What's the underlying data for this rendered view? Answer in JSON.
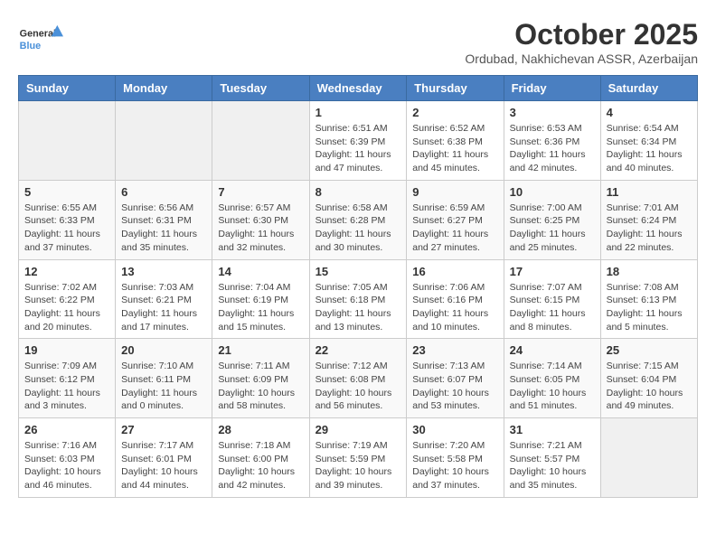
{
  "header": {
    "logo_line1": "General",
    "logo_line2": "Blue",
    "month": "October 2025",
    "location": "Ordubad, Nakhichevan ASSR, Azerbaijan"
  },
  "weekdays": [
    "Sunday",
    "Monday",
    "Tuesday",
    "Wednesday",
    "Thursday",
    "Friday",
    "Saturday"
  ],
  "weeks": [
    [
      {
        "day": "",
        "info": ""
      },
      {
        "day": "",
        "info": ""
      },
      {
        "day": "",
        "info": ""
      },
      {
        "day": "1",
        "info": "Sunrise: 6:51 AM\nSunset: 6:39 PM\nDaylight: 11 hours\nand 47 minutes."
      },
      {
        "day": "2",
        "info": "Sunrise: 6:52 AM\nSunset: 6:38 PM\nDaylight: 11 hours\nand 45 minutes."
      },
      {
        "day": "3",
        "info": "Sunrise: 6:53 AM\nSunset: 6:36 PM\nDaylight: 11 hours\nand 42 minutes."
      },
      {
        "day": "4",
        "info": "Sunrise: 6:54 AM\nSunset: 6:34 PM\nDaylight: 11 hours\nand 40 minutes."
      }
    ],
    [
      {
        "day": "5",
        "info": "Sunrise: 6:55 AM\nSunset: 6:33 PM\nDaylight: 11 hours\nand 37 minutes."
      },
      {
        "day": "6",
        "info": "Sunrise: 6:56 AM\nSunset: 6:31 PM\nDaylight: 11 hours\nand 35 minutes."
      },
      {
        "day": "7",
        "info": "Sunrise: 6:57 AM\nSunset: 6:30 PM\nDaylight: 11 hours\nand 32 minutes."
      },
      {
        "day": "8",
        "info": "Sunrise: 6:58 AM\nSunset: 6:28 PM\nDaylight: 11 hours\nand 30 minutes."
      },
      {
        "day": "9",
        "info": "Sunrise: 6:59 AM\nSunset: 6:27 PM\nDaylight: 11 hours\nand 27 minutes."
      },
      {
        "day": "10",
        "info": "Sunrise: 7:00 AM\nSunset: 6:25 PM\nDaylight: 11 hours\nand 25 minutes."
      },
      {
        "day": "11",
        "info": "Sunrise: 7:01 AM\nSunset: 6:24 PM\nDaylight: 11 hours\nand 22 minutes."
      }
    ],
    [
      {
        "day": "12",
        "info": "Sunrise: 7:02 AM\nSunset: 6:22 PM\nDaylight: 11 hours\nand 20 minutes."
      },
      {
        "day": "13",
        "info": "Sunrise: 7:03 AM\nSunset: 6:21 PM\nDaylight: 11 hours\nand 17 minutes."
      },
      {
        "day": "14",
        "info": "Sunrise: 7:04 AM\nSunset: 6:19 PM\nDaylight: 11 hours\nand 15 minutes."
      },
      {
        "day": "15",
        "info": "Sunrise: 7:05 AM\nSunset: 6:18 PM\nDaylight: 11 hours\nand 13 minutes."
      },
      {
        "day": "16",
        "info": "Sunrise: 7:06 AM\nSunset: 6:16 PM\nDaylight: 11 hours\nand 10 minutes."
      },
      {
        "day": "17",
        "info": "Sunrise: 7:07 AM\nSunset: 6:15 PM\nDaylight: 11 hours\nand 8 minutes."
      },
      {
        "day": "18",
        "info": "Sunrise: 7:08 AM\nSunset: 6:13 PM\nDaylight: 11 hours\nand 5 minutes."
      }
    ],
    [
      {
        "day": "19",
        "info": "Sunrise: 7:09 AM\nSunset: 6:12 PM\nDaylight: 11 hours\nand 3 minutes."
      },
      {
        "day": "20",
        "info": "Sunrise: 7:10 AM\nSunset: 6:11 PM\nDaylight: 11 hours\nand 0 minutes."
      },
      {
        "day": "21",
        "info": "Sunrise: 7:11 AM\nSunset: 6:09 PM\nDaylight: 10 hours\nand 58 minutes."
      },
      {
        "day": "22",
        "info": "Sunrise: 7:12 AM\nSunset: 6:08 PM\nDaylight: 10 hours\nand 56 minutes."
      },
      {
        "day": "23",
        "info": "Sunrise: 7:13 AM\nSunset: 6:07 PM\nDaylight: 10 hours\nand 53 minutes."
      },
      {
        "day": "24",
        "info": "Sunrise: 7:14 AM\nSunset: 6:05 PM\nDaylight: 10 hours\nand 51 minutes."
      },
      {
        "day": "25",
        "info": "Sunrise: 7:15 AM\nSunset: 6:04 PM\nDaylight: 10 hours\nand 49 minutes."
      }
    ],
    [
      {
        "day": "26",
        "info": "Sunrise: 7:16 AM\nSunset: 6:03 PM\nDaylight: 10 hours\nand 46 minutes."
      },
      {
        "day": "27",
        "info": "Sunrise: 7:17 AM\nSunset: 6:01 PM\nDaylight: 10 hours\nand 44 minutes."
      },
      {
        "day": "28",
        "info": "Sunrise: 7:18 AM\nSunset: 6:00 PM\nDaylight: 10 hours\nand 42 minutes."
      },
      {
        "day": "29",
        "info": "Sunrise: 7:19 AM\nSunset: 5:59 PM\nDaylight: 10 hours\nand 39 minutes."
      },
      {
        "day": "30",
        "info": "Sunrise: 7:20 AM\nSunset: 5:58 PM\nDaylight: 10 hours\nand 37 minutes."
      },
      {
        "day": "31",
        "info": "Sunrise: 7:21 AM\nSunset: 5:57 PM\nDaylight: 10 hours\nand 35 minutes."
      },
      {
        "day": "",
        "info": ""
      }
    ]
  ]
}
